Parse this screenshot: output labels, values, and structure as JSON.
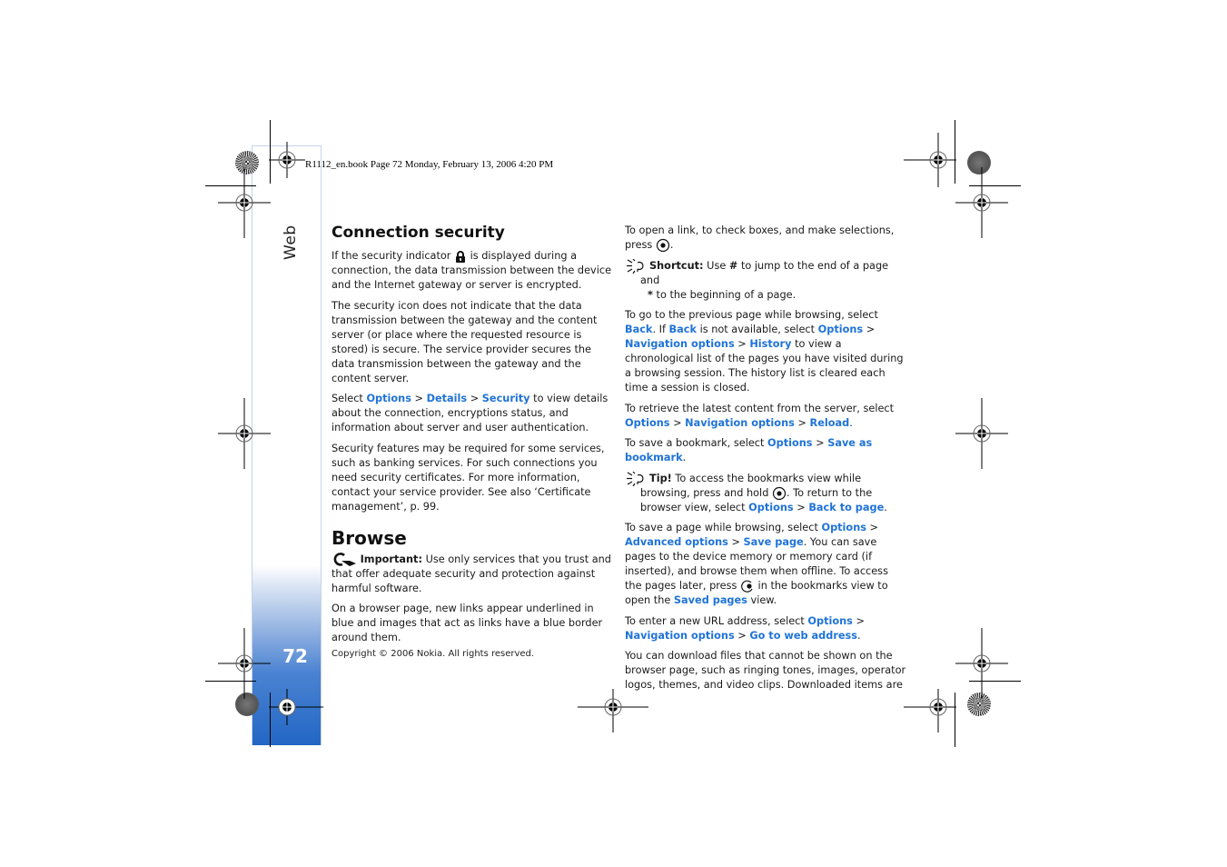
{
  "header": {
    "print_info": "R1112_en.book  Page 72  Monday, February 13, 2006  4:20 PM"
  },
  "sidebar": {
    "section_label": "Web",
    "page_number": "72"
  },
  "column1": {
    "connection_security": {
      "heading": "Connection security",
      "p1_before_icon": "If the security indicator ",
      "p1_after_icon": " is displayed during a connection, the data transmission between the device and the Internet gateway or server is encrypted.",
      "p2": "The security icon does not indicate that the data transmission between the gateway and the content server (or place where the requested resource is stored) is secure. The service provider secures the data transmission between the gateway and the content server.",
      "p3": {
        "t1": "Select ",
        "l1": "Options",
        "sep1": " > ",
        "l2": "Details",
        "sep2": " > ",
        "l3": "Security",
        "t2": " to view details about the connection, encryptions status, and information about server and user authentication."
      },
      "p4": "Security features may be required for some services, such as banking services. For such connections you need security certificates. For more information, contact your service provider. See also ‘Certificate management’, p. 99."
    },
    "browse": {
      "heading": "Browse",
      "important_label": "Important:",
      "important_text": " Use only services that you trust and that offer adequate security and protection against harmful software.",
      "p1": "On a browser page, new links appear underlined in blue and images that act as links have a blue border around them."
    }
  },
  "column2": {
    "p1_text": "To open a link, to check boxes, and make selections, press ",
    "p1_end": ".",
    "shortcut": {
      "label": "Shortcut:",
      "t1": " Use ",
      "key_hash": "#",
      "t2": " to jump to the end of a page and ",
      "key_star": "*",
      "t3": " to the beginning of a page."
    },
    "p2": {
      "t1": "To go to the previous page while browsing, select ",
      "l1": "Back",
      "t2": ". If ",
      "l2": "Back",
      "t3": " is not available, select ",
      "l3": "Options",
      "sep1": " > ",
      "l4": "Navigation options",
      "sep2": " > ",
      "l5": "History",
      "t4": " to view a chronological list of the pages you have visited during a browsing session. The history list is cleared each time a session is closed."
    },
    "p3": {
      "t1": "To retrieve the latest content from the server, select ",
      "l1": "Options",
      "sep1": " > ",
      "l2": "Navigation options",
      "sep2": " > ",
      "l3": "Reload",
      "t2": "."
    },
    "p4": {
      "t1": "To save a bookmark, select ",
      "l1": "Options",
      "sep1": " > ",
      "l2": "Save as bookmark",
      "t2": "."
    },
    "tip": {
      "label": "Tip!",
      "t1": " To access the bookmarks view while browsing, press and hold ",
      "t2": ". To return to the browser view, select ",
      "l1": "Options",
      "sep1": " > ",
      "l2": "Back to page",
      "t3": "."
    },
    "p5": {
      "t1": "To save a page while browsing, select ",
      "l1": "Options",
      "sep1": " > ",
      "l2": "Advanced options",
      "sep2": " > ",
      "l3": "Save page",
      "t2": ". You can save pages to the device memory or memory card (if inserted), and browse them when offline. To access the pages later, press ",
      "t3": " in the bookmarks view to open the ",
      "l4": "Saved pages",
      "t4": " view."
    },
    "p6": {
      "t1": "To enter a new URL address, select ",
      "l1": "Options",
      "sep1": " > ",
      "l2": "Navigation options",
      "sep2": " > ",
      "l3": "Go to web address",
      "t2": "."
    },
    "p7": "You can download files that cannot be shown on the browser page, such as ringing tones, images, operator logos, themes, and video clips. Downloaded items are"
  },
  "footer": {
    "copyright": "Copyright © 2006 Nokia. All rights reserved."
  },
  "colors": {
    "link": "#1f73d8",
    "sidebar_gradient_end": "#2267c4"
  }
}
